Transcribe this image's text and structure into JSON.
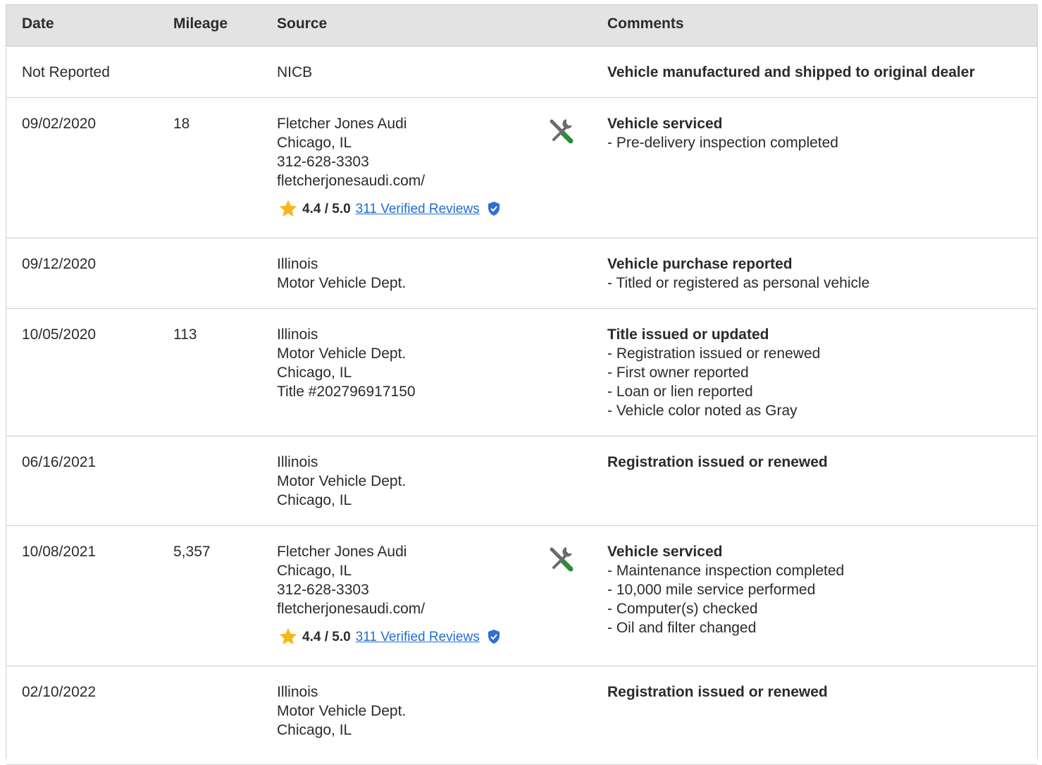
{
  "header": {
    "date": "Date",
    "mileage": "Mileage",
    "source": "Source",
    "comments": "Comments"
  },
  "rows": [
    {
      "date": "Not Reported",
      "mileage": "",
      "source": [
        "NICB"
      ],
      "comment_title": "Vehicle manufactured and shipped to original dealer",
      "comment_items": []
    },
    {
      "date": "09/02/2020",
      "mileage": "18",
      "source": [
        "Fletcher Jones Audi",
        "Chicago, IL",
        "312-628-3303",
        "fletcherjonesaudi.com/"
      ],
      "rating": {
        "score": "4.4 / 5.0",
        "reviews": "311 Verified Reviews"
      },
      "icon": "service-tools-icon",
      "comment_title": "Vehicle serviced",
      "comment_items": [
        "- Pre-delivery inspection completed"
      ]
    },
    {
      "date": "09/12/2020",
      "mileage": "",
      "source": [
        "Illinois",
        "Motor Vehicle Dept."
      ],
      "comment_title": "Vehicle purchase reported",
      "comment_items": [
        "- Titled or registered as personal vehicle"
      ]
    },
    {
      "date": "10/05/2020",
      "mileage": "113",
      "source": [
        "Illinois",
        "Motor Vehicle Dept.",
        "Chicago, IL",
        "Title #202796917150"
      ],
      "comment_title": "Title issued or updated",
      "comment_items": [
        "- Registration issued or renewed",
        "- First owner reported",
        "- Loan or lien reported",
        "- Vehicle color noted as Gray"
      ]
    },
    {
      "date": "06/16/2021",
      "mileage": "",
      "source": [
        "Illinois",
        "Motor Vehicle Dept.",
        "Chicago, IL"
      ],
      "comment_title": "Registration issued or renewed",
      "comment_items": []
    },
    {
      "date": "10/08/2021",
      "mileage": "5,357",
      "source": [
        "Fletcher Jones Audi",
        "Chicago, IL",
        "312-628-3303",
        "fletcherjonesaudi.com/"
      ],
      "rating": {
        "score": "4.4 / 5.0",
        "reviews": "311 Verified Reviews"
      },
      "icon": "service-tools-icon",
      "comment_title": "Vehicle serviced",
      "comment_items": [
        "- Maintenance inspection completed",
        "- 10,000 mile service performed",
        "- Computer(s) checked",
        "- Oil and filter changed"
      ]
    },
    {
      "date": "02/10/2022",
      "mileage": "",
      "source": [
        "Illinois",
        "Motor Vehicle Dept.",
        "Chicago, IL"
      ],
      "comment_title": "Registration issued or renewed",
      "comment_items": []
    }
  ],
  "colors": {
    "header_bg": "#e3e3e3",
    "link": "#1f6fd0",
    "star": "#f5b81c",
    "shield": "#2f6fd6",
    "tool_green": "#2e8b3a",
    "tool_gray": "#6b6b6b"
  }
}
